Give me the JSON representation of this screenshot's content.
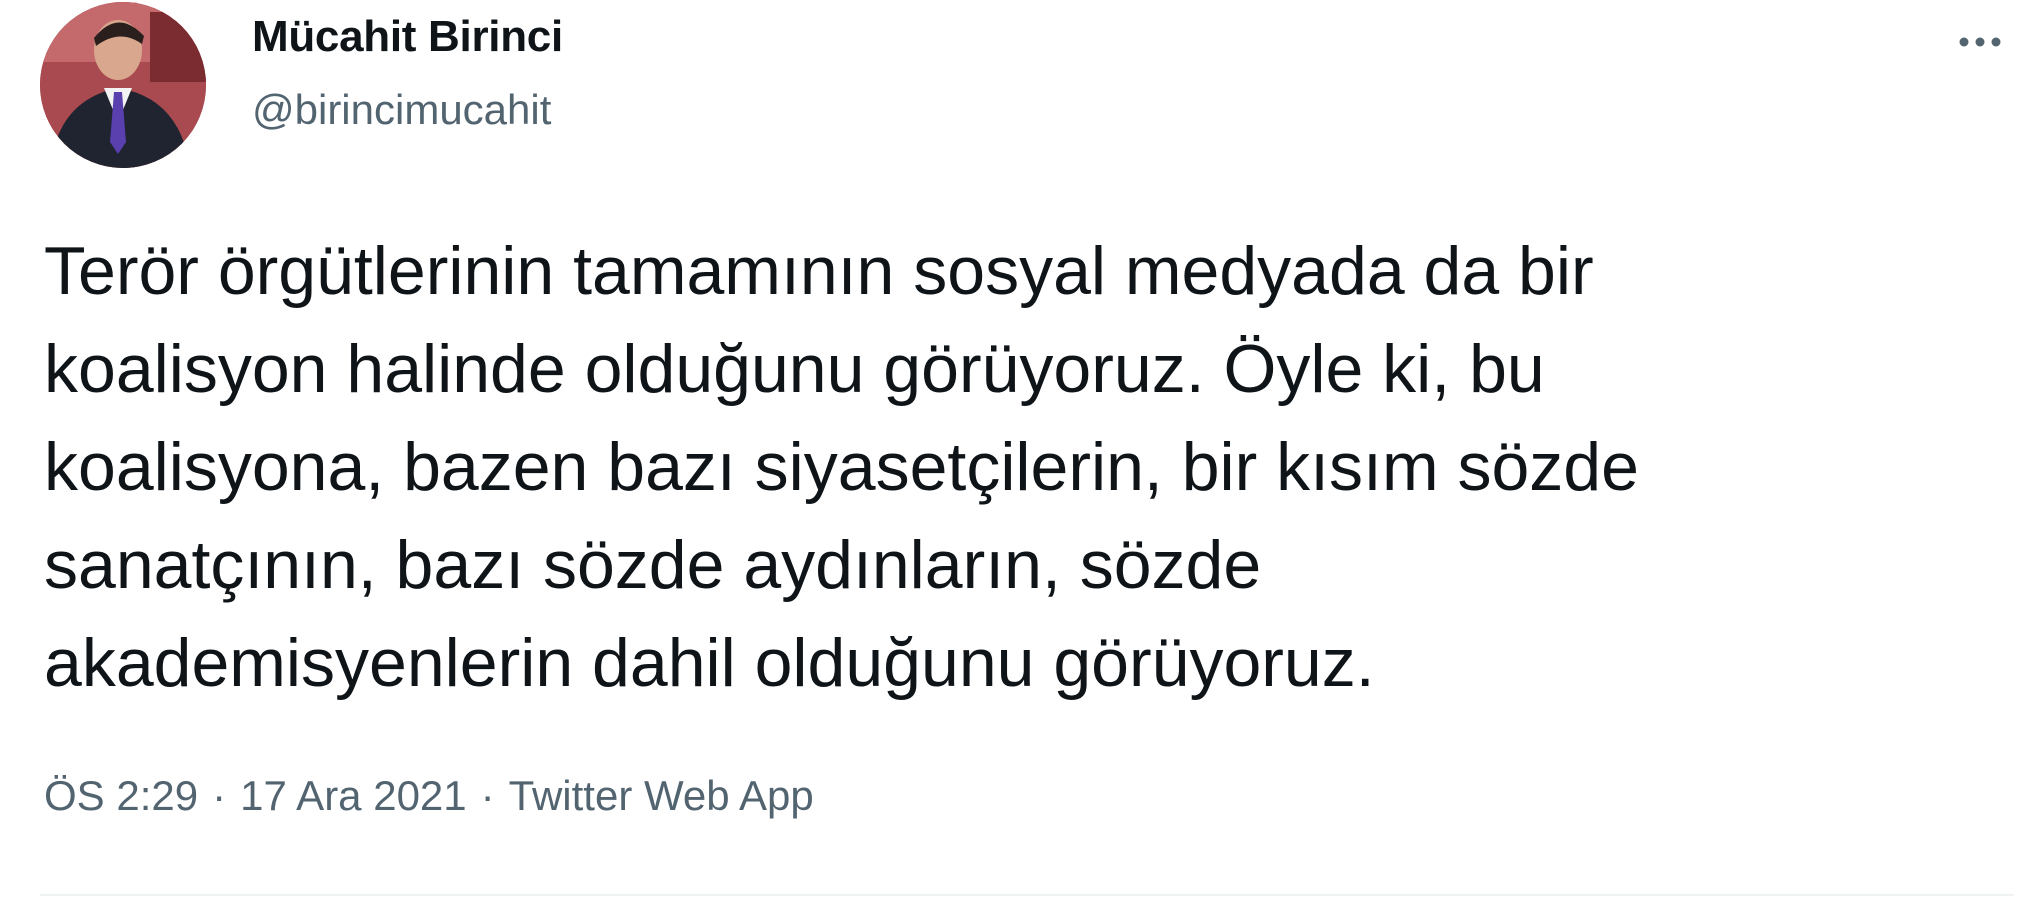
{
  "tweet": {
    "author": {
      "display_name": "Mücahit Birinci",
      "handle": "@birincimucahit",
      "avatar_icon": "profile-photo"
    },
    "more_icon": "more-horizontal-icon",
    "text": "Terör örgütlerinin tamamının sosyal medyada da bir\nkoalisyon halinde olduğunu görüyoruz. Öyle ki, bu\nkoalisyona, bazen bazı siyasetçilerin, bir kısım sözde\nsanatçının, bazı sözde aydınların, sözde\nakademisyenlerin dahil olduğunu görüyoruz.",
    "meta": {
      "time": "ÖS 2:29",
      "separator": "·",
      "date": "17 Ara 2021",
      "source": "Twitter Web App"
    }
  },
  "colors": {
    "text_primary": "#0f1419",
    "text_secondary": "#536471",
    "divider": "#eff3f4",
    "background": "#ffffff"
  }
}
